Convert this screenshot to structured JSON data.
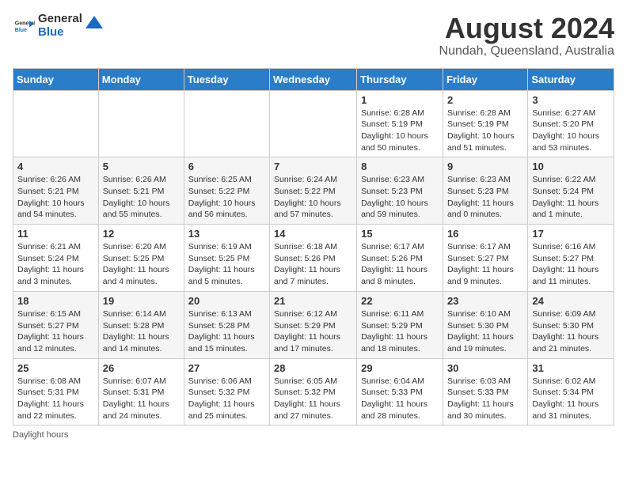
{
  "header": {
    "logo_general": "General",
    "logo_blue": "Blue",
    "month_title": "August 2024",
    "location": "Nundah, Queensland, Australia"
  },
  "days_of_week": [
    "Sunday",
    "Monday",
    "Tuesday",
    "Wednesday",
    "Thursday",
    "Friday",
    "Saturday"
  ],
  "weeks": [
    [
      {
        "day": "",
        "sunrise": "",
        "sunset": "",
        "daylight": ""
      },
      {
        "day": "",
        "sunrise": "",
        "sunset": "",
        "daylight": ""
      },
      {
        "day": "",
        "sunrise": "",
        "sunset": "",
        "daylight": ""
      },
      {
        "day": "",
        "sunrise": "",
        "sunset": "",
        "daylight": ""
      },
      {
        "day": "1",
        "sunrise": "6:28 AM",
        "sunset": "5:19 PM",
        "daylight": "10 hours and 50 minutes."
      },
      {
        "day": "2",
        "sunrise": "6:28 AM",
        "sunset": "5:19 PM",
        "daylight": "10 hours and 51 minutes."
      },
      {
        "day": "3",
        "sunrise": "6:27 AM",
        "sunset": "5:20 PM",
        "daylight": "10 hours and 53 minutes."
      }
    ],
    [
      {
        "day": "4",
        "sunrise": "6:26 AM",
        "sunset": "5:21 PM",
        "daylight": "10 hours and 54 minutes."
      },
      {
        "day": "5",
        "sunrise": "6:26 AM",
        "sunset": "5:21 PM",
        "daylight": "10 hours and 55 minutes."
      },
      {
        "day": "6",
        "sunrise": "6:25 AM",
        "sunset": "5:22 PM",
        "daylight": "10 hours and 56 minutes."
      },
      {
        "day": "7",
        "sunrise": "6:24 AM",
        "sunset": "5:22 PM",
        "daylight": "10 hours and 57 minutes."
      },
      {
        "day": "8",
        "sunrise": "6:23 AM",
        "sunset": "5:23 PM",
        "daylight": "10 hours and 59 minutes."
      },
      {
        "day": "9",
        "sunrise": "6:23 AM",
        "sunset": "5:23 PM",
        "daylight": "11 hours and 0 minutes."
      },
      {
        "day": "10",
        "sunrise": "6:22 AM",
        "sunset": "5:24 PM",
        "daylight": "11 hours and 1 minute."
      }
    ],
    [
      {
        "day": "11",
        "sunrise": "6:21 AM",
        "sunset": "5:24 PM",
        "daylight": "11 hours and 3 minutes."
      },
      {
        "day": "12",
        "sunrise": "6:20 AM",
        "sunset": "5:25 PM",
        "daylight": "11 hours and 4 minutes."
      },
      {
        "day": "13",
        "sunrise": "6:19 AM",
        "sunset": "5:25 PM",
        "daylight": "11 hours and 5 minutes."
      },
      {
        "day": "14",
        "sunrise": "6:18 AM",
        "sunset": "5:26 PM",
        "daylight": "11 hours and 7 minutes."
      },
      {
        "day": "15",
        "sunrise": "6:17 AM",
        "sunset": "5:26 PM",
        "daylight": "11 hours and 8 minutes."
      },
      {
        "day": "16",
        "sunrise": "6:17 AM",
        "sunset": "5:27 PM",
        "daylight": "11 hours and 9 minutes."
      },
      {
        "day": "17",
        "sunrise": "6:16 AM",
        "sunset": "5:27 PM",
        "daylight": "11 hours and 11 minutes."
      }
    ],
    [
      {
        "day": "18",
        "sunrise": "6:15 AM",
        "sunset": "5:27 PM",
        "daylight": "11 hours and 12 minutes."
      },
      {
        "day": "19",
        "sunrise": "6:14 AM",
        "sunset": "5:28 PM",
        "daylight": "11 hours and 14 minutes."
      },
      {
        "day": "20",
        "sunrise": "6:13 AM",
        "sunset": "5:28 PM",
        "daylight": "11 hours and 15 minutes."
      },
      {
        "day": "21",
        "sunrise": "6:12 AM",
        "sunset": "5:29 PM",
        "daylight": "11 hours and 17 minutes."
      },
      {
        "day": "22",
        "sunrise": "6:11 AM",
        "sunset": "5:29 PM",
        "daylight": "11 hours and 18 minutes."
      },
      {
        "day": "23",
        "sunrise": "6:10 AM",
        "sunset": "5:30 PM",
        "daylight": "11 hours and 19 minutes."
      },
      {
        "day": "24",
        "sunrise": "6:09 AM",
        "sunset": "5:30 PM",
        "daylight": "11 hours and 21 minutes."
      }
    ],
    [
      {
        "day": "25",
        "sunrise": "6:08 AM",
        "sunset": "5:31 PM",
        "daylight": "11 hours and 22 minutes."
      },
      {
        "day": "26",
        "sunrise": "6:07 AM",
        "sunset": "5:31 PM",
        "daylight": "11 hours and 24 minutes."
      },
      {
        "day": "27",
        "sunrise": "6:06 AM",
        "sunset": "5:32 PM",
        "daylight": "11 hours and 25 minutes."
      },
      {
        "day": "28",
        "sunrise": "6:05 AM",
        "sunset": "5:32 PM",
        "daylight": "11 hours and 27 minutes."
      },
      {
        "day": "29",
        "sunrise": "6:04 AM",
        "sunset": "5:33 PM",
        "daylight": "11 hours and 28 minutes."
      },
      {
        "day": "30",
        "sunrise": "6:03 AM",
        "sunset": "5:33 PM",
        "daylight": "11 hours and 30 minutes."
      },
      {
        "day": "31",
        "sunrise": "6:02 AM",
        "sunset": "5:34 PM",
        "daylight": "11 hours and 31 minutes."
      }
    ]
  ],
  "footer": {
    "daylight_label": "Daylight hours"
  }
}
